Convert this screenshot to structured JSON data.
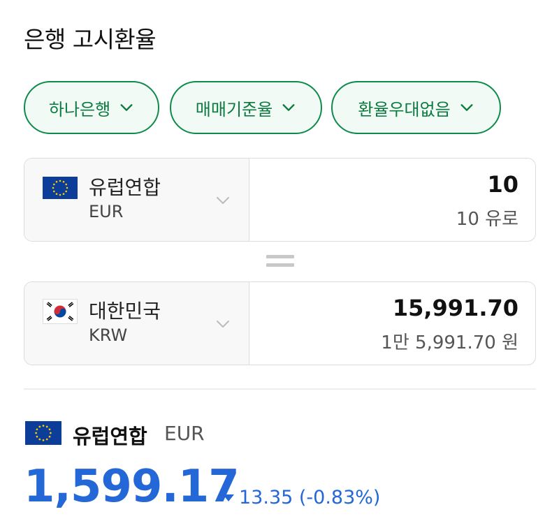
{
  "header": {
    "title": "은행 고시환율"
  },
  "filters": [
    {
      "label": "하나은행"
    },
    {
      "label": "매매기준율"
    },
    {
      "label": "환율우대없음"
    }
  ],
  "from": {
    "country": "유럽연합",
    "code": "EUR",
    "amount": "10",
    "amount_text": "10 유로",
    "flag": "eu-flag-icon"
  },
  "to": {
    "country": "대한민국",
    "code": "KRW",
    "amount": "15,991.70",
    "amount_text": "1만 5,991.70 원",
    "flag": "kr-flag-icon"
  },
  "rate_info": {
    "country": "유럽연합",
    "code": "EUR",
    "rate": "1,599.17",
    "change": "13.35 (-0.83%)",
    "direction": "down"
  },
  "colors": {
    "accent_green": "#0e8b4c",
    "rate_blue": "#2467d6",
    "eu_blue": "#0c3d99"
  }
}
